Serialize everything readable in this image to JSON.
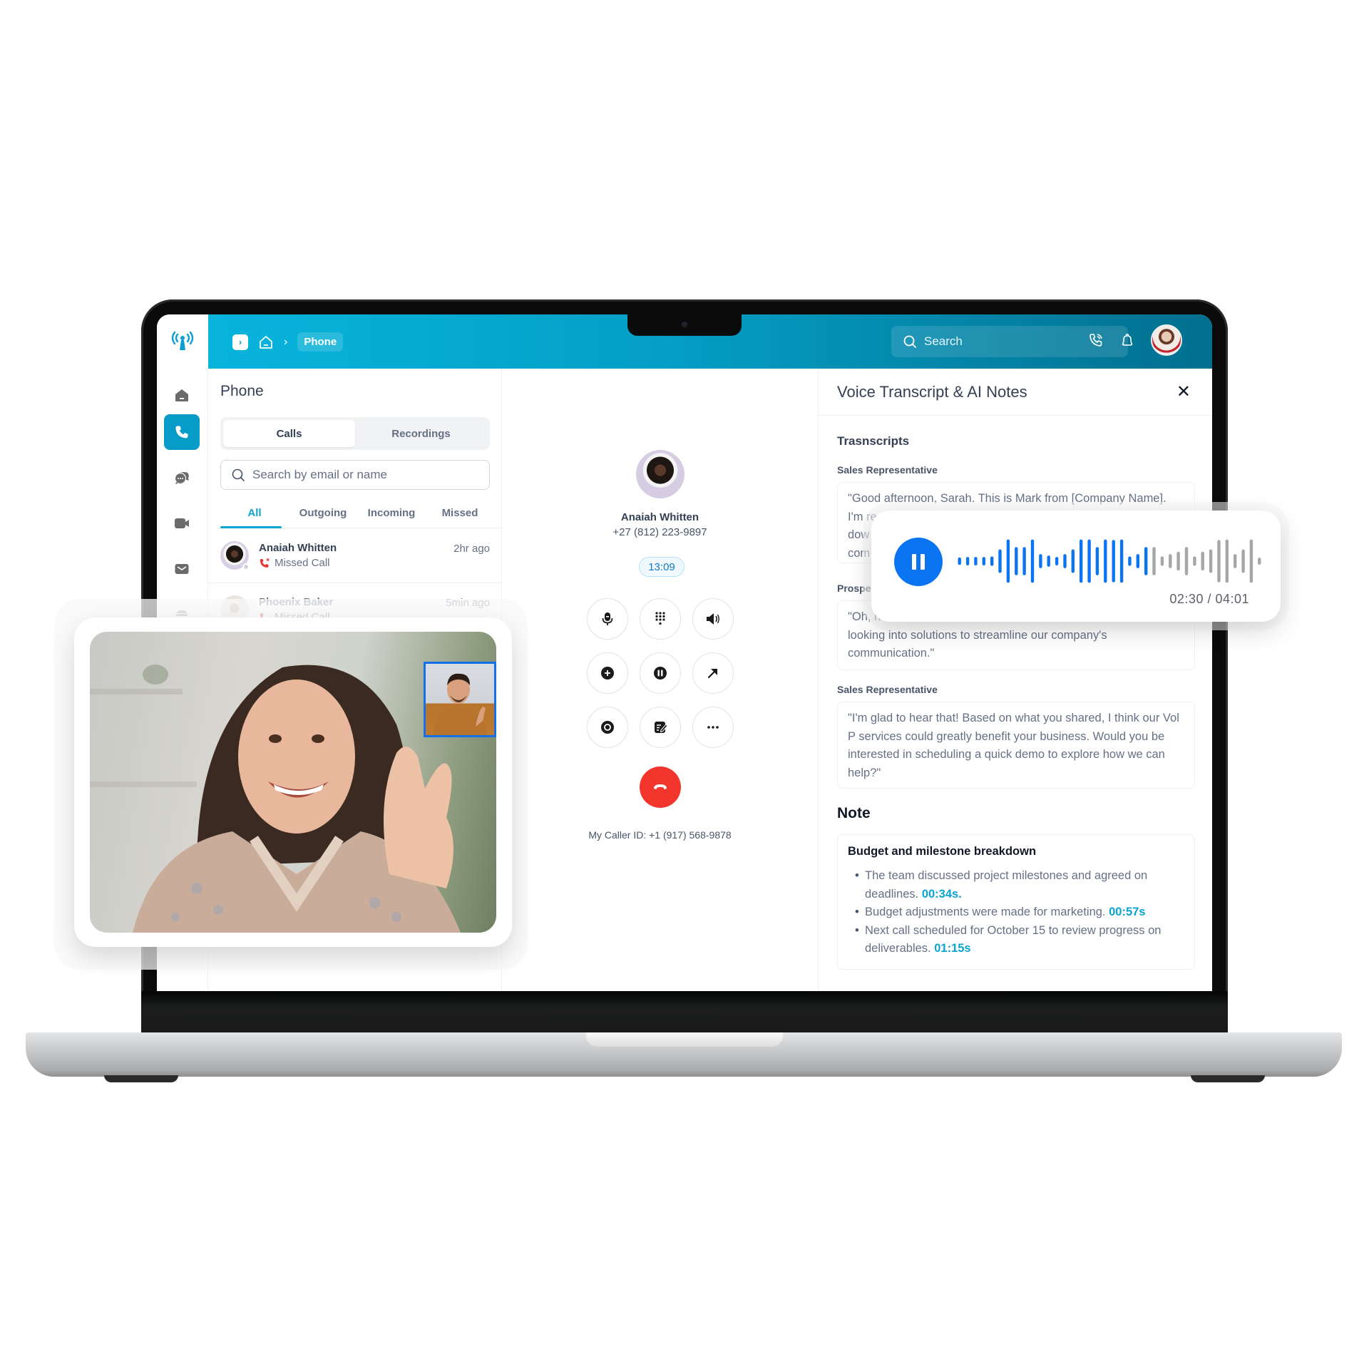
{
  "header": {
    "breadcrumb_current": "Phone",
    "search_placeholder": "Search"
  },
  "sidebar": {
    "items": [
      {
        "name": "home",
        "icon": "home-icon"
      },
      {
        "name": "phone",
        "icon": "phone-icon",
        "active": true
      },
      {
        "name": "chat",
        "icon": "chat-bubbles-icon"
      },
      {
        "name": "video",
        "icon": "video-camera-icon"
      },
      {
        "name": "mail",
        "icon": "mail-icon"
      },
      {
        "name": "more",
        "icon": "stack-icon"
      }
    ]
  },
  "phone_panel": {
    "title": "Phone",
    "segments": [
      "Calls",
      "Recordings"
    ],
    "active_segment": "Calls",
    "search_placeholder": "Search by email or name",
    "filters": [
      "All",
      "Outgoing",
      "Incoming",
      "Missed"
    ],
    "active_filter": "All",
    "calls": [
      {
        "name": "Anaiah Whitten",
        "status": "Missed Call",
        "time": "2hr ago"
      },
      {
        "name": "Phoenix Baker",
        "status": "Missed Call",
        "time": "5min ago"
      }
    ]
  },
  "dialer": {
    "contact_name": "Anaiah Whitten",
    "contact_phone": "+27 (812) 223-9897",
    "timer": "13:09",
    "controls": [
      "mute",
      "keypad",
      "speaker",
      "add-call",
      "hold",
      "transfer",
      "record",
      "notes",
      "more"
    ],
    "caller_id": "My Caller ID: +1 (917) 568-9878"
  },
  "transcript_panel": {
    "title": "Voice Transcript & AI Notes",
    "section_title": "Trasnscripts",
    "entries": [
      {
        "speaker": "Sales Representative",
        "text": "\"Good afternoon, Sarah. This is Mark from [Company Name]. I'm re... dow... com..."
      },
      {
        "speaker": "Prospe...",
        "text": "\"Oh, h... looking into solutions to streamline our company's communication.\""
      },
      {
        "speaker": "Sales Representative",
        "text": "\"I'm glad to hear that! Based on what you shared, I think our Vol P services could greatly benefit your business. Would you be interested in scheduling a quick demo to explore how we can help?\""
      }
    ],
    "entry1_line1": "\"Good afternoon, Sarah. This is Mark from [Company Name].",
    "entry1_line2": "I'm re",
    "entry1_line3": "dow",
    "entry1_line4": "com",
    "entry2_speaker_visible": "Prospe",
    "entry2_line1": "\"Oh, h",
    "entry2_line2": "looking into solutions to streamline our company's",
    "entry2_line3": "communication.\"",
    "entry3_text": "\"I'm glad to hear that! Based on what you shared, I think our Vol P services could greatly benefit your business. Would you be interested in scheduling a quick demo to explore how we can help?\"",
    "note_heading": "Note",
    "note": {
      "title": "Budget and milestone breakdown",
      "items": [
        {
          "text": "The team discussed project milestones and agreed on deadlines. ",
          "timestamp": "00:34s."
        },
        {
          "text": "Budget adjustments were made for marketing. ",
          "timestamp": "00:57s"
        },
        {
          "text": "Next call scheduled for October 15 to review progress on deliverables. ",
          "timestamp": "01:15s"
        }
      ]
    }
  },
  "audio_player": {
    "state": "playing",
    "current_time": "02:30",
    "total_time": "04:01",
    "display": "02:30 / 04:01",
    "progress_fraction": 0.62,
    "played_color": "#0B74F1",
    "unplayed_color": "#A6A6A6"
  },
  "video_call": {
    "main_participant": "remote-video",
    "pip_participant": "self-video"
  },
  "colors": {
    "accent": "#079BC8",
    "hangup": "#F2352D",
    "timestamp": "#0AA4D2"
  }
}
